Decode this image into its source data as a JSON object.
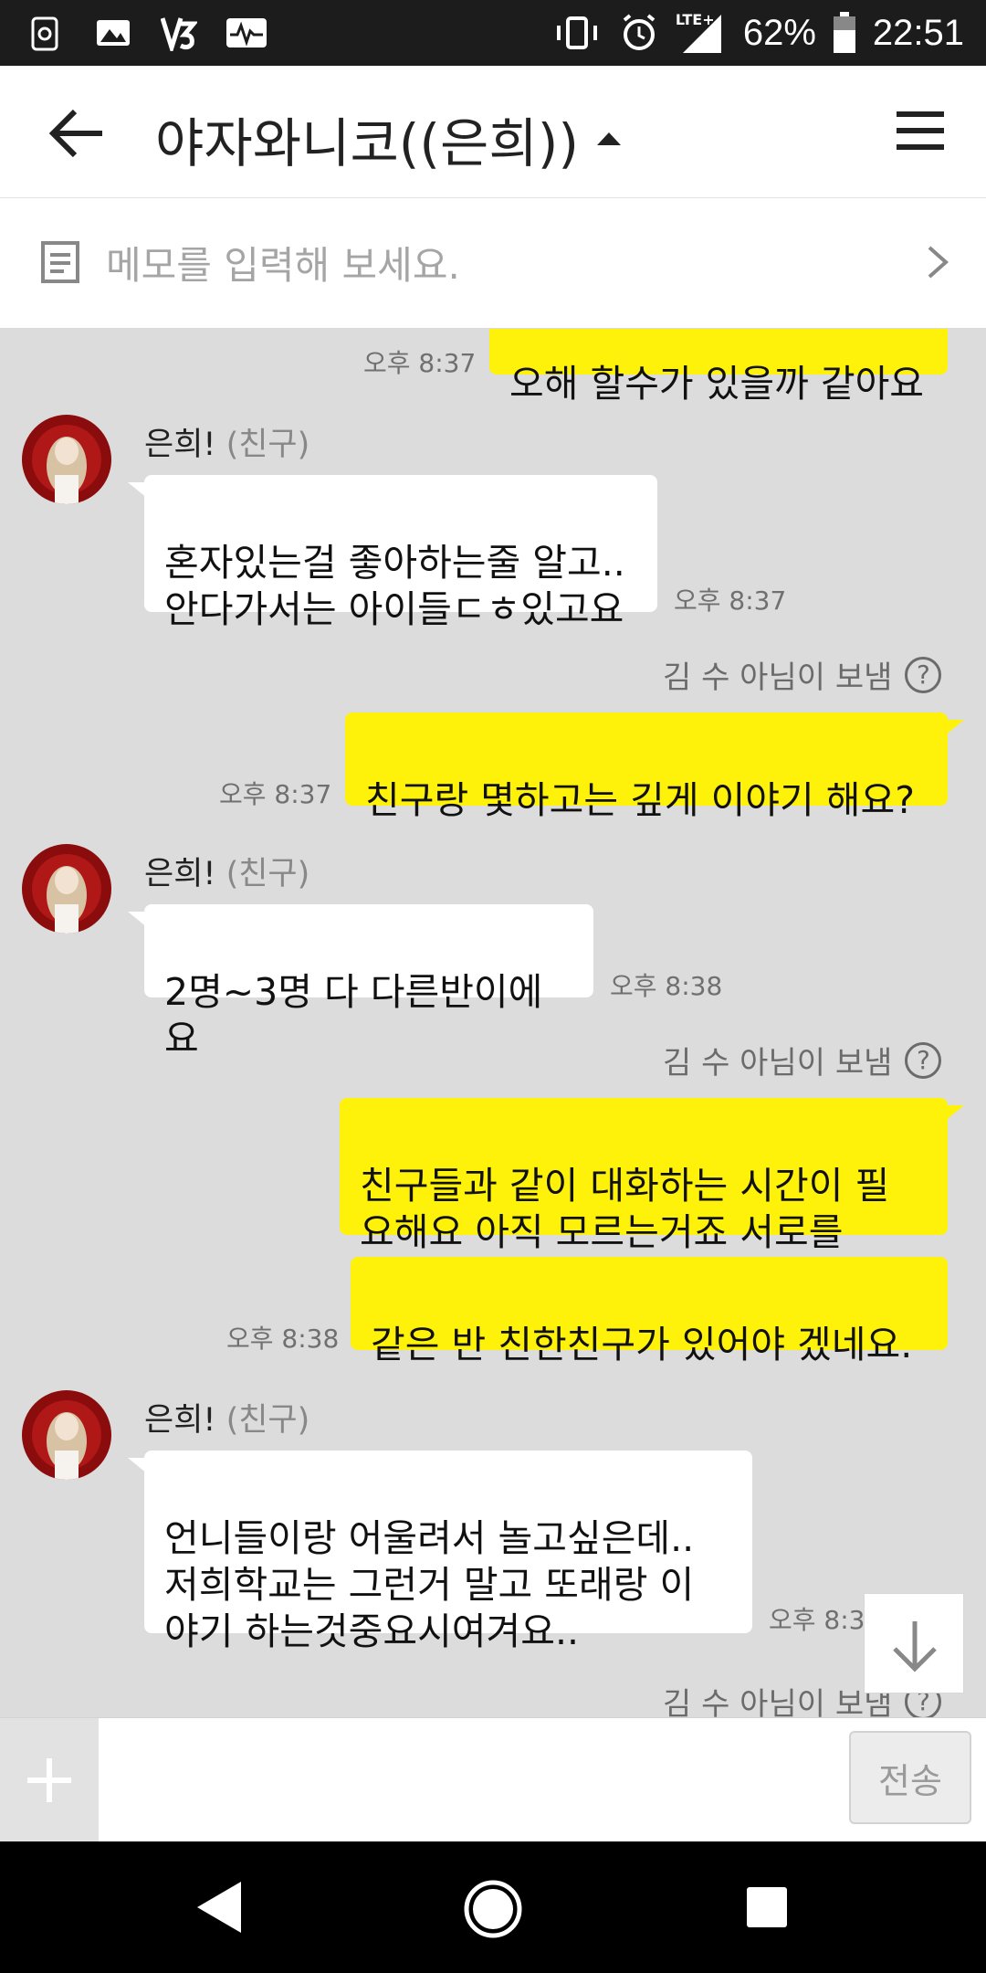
{
  "status_bar": {
    "battery_percent": "62%",
    "time": "22:51",
    "network": "LTE+",
    "icons": [
      "app-icon",
      "gallery-icon",
      "v3-icon",
      "activity-icon",
      "vibrate-icon",
      "alarm-icon",
      "signal-icon",
      "battery-icon"
    ]
  },
  "header": {
    "title": "야자와니코((은희))",
    "icons": [
      "back-arrow-icon",
      "caret-up-icon",
      "menu-icon"
    ]
  },
  "memo": {
    "placeholder": "메모를 입력해 보세요."
  },
  "friend": {
    "name": "은희!",
    "tag": "(친구)"
  },
  "sent_note": "김 수 아님이 보냄",
  "messages": [
    {
      "from": "me",
      "text": "오해 할수가 있을까 같아요",
      "time": "오후 8:37"
    },
    {
      "from": "friend",
      "text": "혼자있는걸 좋아하는줄 알고..\n안다가서는 아이들ㄷㅎ있고요",
      "time": "오후 8:37"
    },
    {
      "from": "me",
      "text": "친구랑 몇하고는 깊게 이야기 해요?",
      "time": "오후 8:37"
    },
    {
      "from": "friend",
      "text": "2명~3명 다 다른반이에요",
      "time": "오후 8:38"
    },
    {
      "from": "me",
      "text": "친구들과 같이 대화하는 시간이 필\n요해요 아직 모르는거죠 서로를"
    },
    {
      "from": "me",
      "text": "같은 반 친한친구가 있어야 겠네요.",
      "time": "오후 8:38"
    },
    {
      "from": "friend",
      "text": "언니들이랑 어울려서 놀고싶은데..\n저희학교는 그런거 말고 또래랑 이\n야기 하는것중요시여겨요..",
      "time": "오후 8:3"
    }
  ],
  "input": {
    "send_label": "전송",
    "plus_icon": "plus-icon"
  },
  "nav": {
    "icons": [
      "back-triangle-icon",
      "home-circle-icon",
      "recents-square-icon"
    ]
  },
  "colors": {
    "my_bubble": "#fff20a",
    "chat_bg": "#dcdcdc"
  }
}
